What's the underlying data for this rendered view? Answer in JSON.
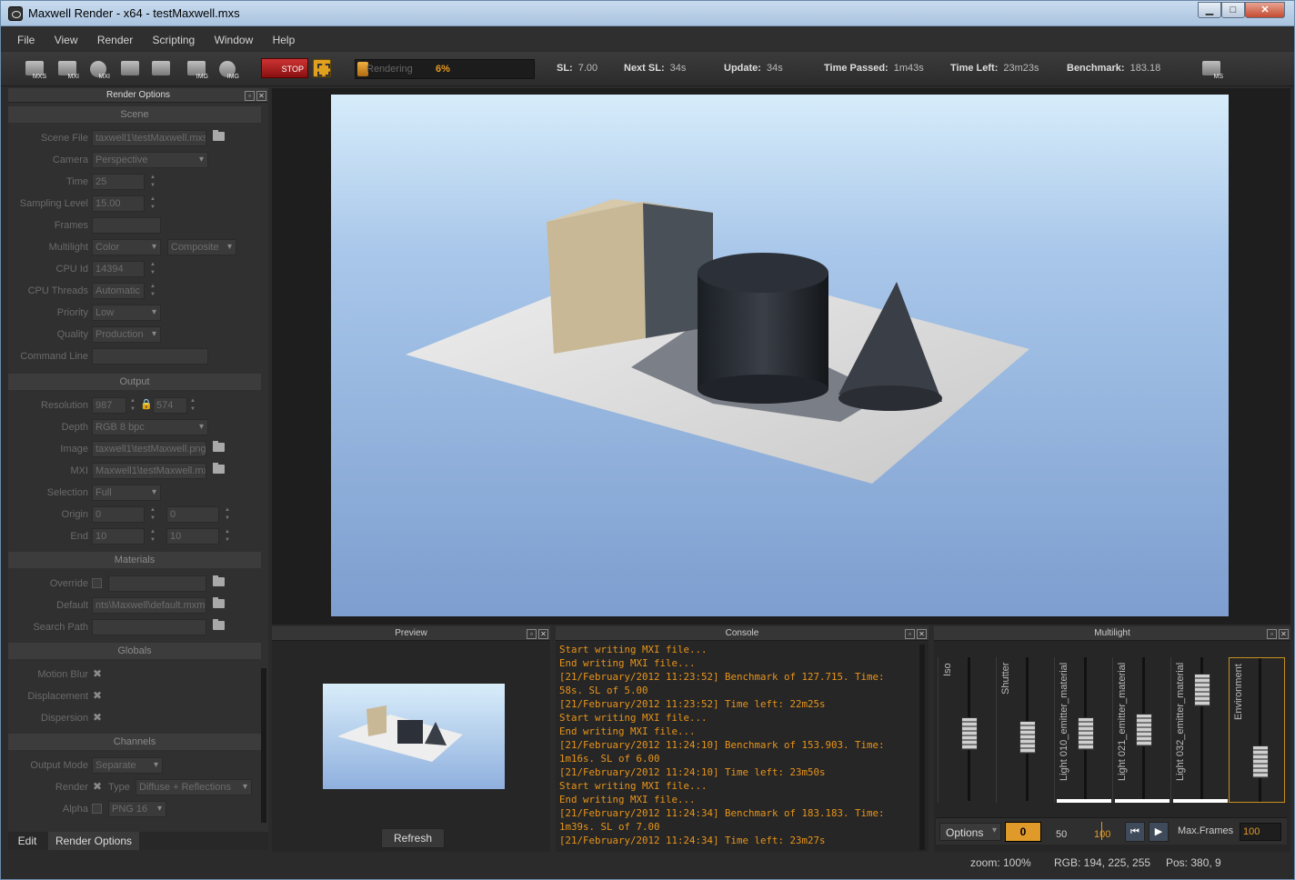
{
  "window": {
    "title": "Maxwell Render  -  x64 - testMaxwell.mxs",
    "min": "▁",
    "max": "□",
    "close": "✕"
  },
  "menu": [
    "File",
    "View",
    "Render",
    "Scripting",
    "Window",
    "Help"
  ],
  "toolbar": {
    "buttons": [
      {
        "cap": "MXS"
      },
      {
        "cap": "MXI"
      },
      {
        "cap": "MXI"
      },
      {
        "cap": ""
      },
      {
        "cap": ""
      },
      {
        "cap": "IMG"
      },
      {
        "cap": "IMG"
      }
    ],
    "stop_label": "STOP",
    "progress_label": "Rendering",
    "progress_pct": "6%",
    "progress_fraction": 0.06,
    "ms_cap": "MS"
  },
  "stats": [
    {
      "k": "SL:",
      "v": "7.00"
    },
    {
      "k": "Next SL:",
      "v": "34s"
    },
    {
      "k": "Update:",
      "v": "34s"
    },
    {
      "k": "Time Passed:",
      "v": "1m43s"
    },
    {
      "k": "Time Left:",
      "v": "23m23s"
    },
    {
      "k": "Benchmark:",
      "v": "183.18"
    }
  ],
  "render_options": {
    "title": "Render Options",
    "sections": {
      "scene": "Scene",
      "output": "Output",
      "materials": "Materials",
      "globals": "Globals",
      "channels": "Channels"
    },
    "scene": {
      "scene_file": {
        "label": "Scene File",
        "value": "taxwell1\\testMaxwell.mxs"
      },
      "camera": {
        "label": "Camera",
        "value": "Perspective"
      },
      "time": {
        "label": "Time",
        "value": "25"
      },
      "sampling": {
        "label": "Sampling Level",
        "value": "15.00"
      },
      "frames": {
        "label": "Frames",
        "value": ""
      },
      "multilight": {
        "label": "Multilight",
        "value": "Color",
        "value2": "Composite"
      },
      "cpu_id": {
        "label": "CPU Id",
        "value": "14394"
      },
      "cpu_threads": {
        "label": "CPU Threads",
        "value": "Automatic"
      },
      "priority": {
        "label": "Priority",
        "value": "Low"
      },
      "quality": {
        "label": "Quality",
        "value": "Production"
      },
      "command": {
        "label": "Command Line",
        "value": ""
      }
    },
    "output": {
      "resolution": {
        "label": "Resolution",
        "w": "987",
        "h": "574"
      },
      "depth": {
        "label": "Depth",
        "value": "RGB  8 bpc"
      },
      "image": {
        "label": "Image",
        "value": "taxwell1\\testMaxwell.png"
      },
      "mxi": {
        "label": "MXI",
        "value": "Maxwell1\\testMaxwell.mxi"
      },
      "selection": {
        "label": "Selection",
        "value": "Full"
      },
      "origin": {
        "label": "Origin",
        "x": "0",
        "y": "0"
      },
      "end": {
        "label": "End",
        "x": "10",
        "y": "10"
      }
    },
    "materials": {
      "override": {
        "label": "Override",
        "value": ""
      },
      "default": {
        "label": "Default",
        "value": "nts\\Maxwell\\default.mxm"
      },
      "search": {
        "label": "Search Path",
        "value": ""
      }
    },
    "globals": {
      "motion_blur": "Motion Blur",
      "displacement": "Displacement",
      "dispersion": "Dispersion"
    },
    "channels": {
      "output_mode": {
        "label": "Output Mode",
        "value": "Separate"
      },
      "render": {
        "label": "Render",
        "type_label": "Type",
        "type_value": "Diffuse + Reflections"
      },
      "alpha": {
        "label": "Alpha",
        "value": "PNG 16"
      }
    }
  },
  "left_tabs": [
    "Edit",
    "Render Options"
  ],
  "preview": {
    "title": "Preview",
    "refresh": "Refresh"
  },
  "console": {
    "title": "Console",
    "lines": [
      "Start writing MXI file...",
      "End writing MXI file...",
      "[21/February/2012 11:23:52] Benchmark of 127.715. Time:",
      "58s. SL of 5.00",
      "[21/February/2012 11:23:52] Time left: 22m25s",
      "Start writing MXI file...",
      "End writing MXI file...",
      "[21/February/2012 11:24:10] Benchmark of 153.903. Time:",
      "1m16s. SL of 6.00",
      "[21/February/2012 11:24:10] Time left: 23m50s",
      "Start writing MXI file...",
      "End writing MXI file...",
      "[21/February/2012 11:24:34] Benchmark of 183.183. Time:",
      "1m39s. SL of 7.00",
      "[21/February/2012 11:24:34] Time left: 23m27s"
    ]
  },
  "multilight": {
    "title": "Multilight",
    "faders": [
      {
        "label": "Iso",
        "level": 0.45,
        "bar": false
      },
      {
        "label": "Shutter",
        "level": 0.42,
        "bar": false
      },
      {
        "label": "Light 010_emitter_material",
        "level": 0.45,
        "bar": true
      },
      {
        "label": "Light 021_emitter_material",
        "level": 0.48,
        "bar": true
      },
      {
        "label": "Light 032_emitter_material",
        "level": 0.85,
        "bar": true
      },
      {
        "label": "Environment",
        "level": 0.2,
        "bar": false
      }
    ],
    "options": "Options",
    "frame": "0",
    "tick50": "50",
    "tick100": "100",
    "max_frames_label": "Max.Frames",
    "max_frames": "100"
  },
  "status": {
    "zoom": "zoom: 100%",
    "rgb": "RGB: 194, 225, 255",
    "pos": "Pos: 380, 9"
  }
}
